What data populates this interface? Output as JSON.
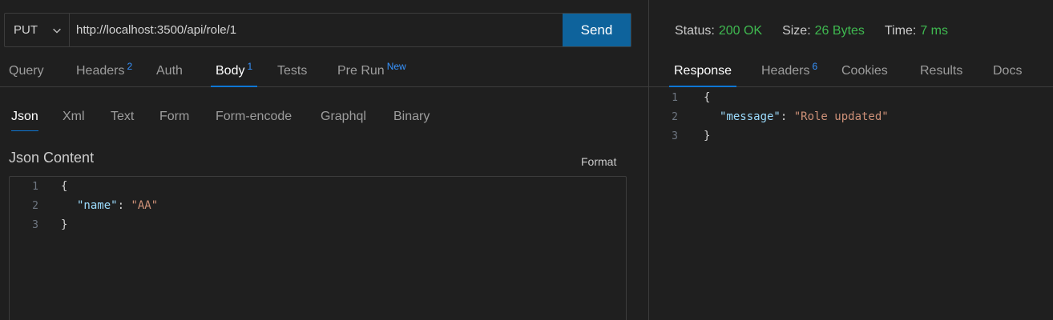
{
  "request": {
    "method": "PUT",
    "url": "http://localhost:3500/api/role/1",
    "send_label": "Send",
    "tabs": [
      {
        "label": "Query",
        "badge": ""
      },
      {
        "label": "Headers",
        "badge": "2"
      },
      {
        "label": "Auth",
        "badge": ""
      },
      {
        "label": "Body",
        "badge": "1"
      },
      {
        "label": "Tests",
        "badge": ""
      },
      {
        "label": "Pre Run",
        "badge": "New"
      }
    ],
    "active_tab": "Body",
    "body_types": [
      "Json",
      "Xml",
      "Text",
      "Form",
      "Form-encode",
      "Graphql",
      "Binary"
    ],
    "active_body_type": "Json",
    "content_label": "Json Content",
    "format_label": "Format",
    "editor_lines": [
      {
        "num": "1",
        "text": "{"
      },
      {
        "num": "2",
        "key": "\"name\"",
        "sep": ": ",
        "value": "\"AA\""
      },
      {
        "num": "3",
        "text": "}"
      }
    ]
  },
  "response": {
    "status_label": "Status:",
    "status_value": "200 OK",
    "size_label": "Size:",
    "size_value": "26 Bytes",
    "time_label": "Time:",
    "time_value": "7 ms",
    "tabs": [
      {
        "label": "Response",
        "badge": ""
      },
      {
        "label": "Headers",
        "badge": "6"
      },
      {
        "label": "Cookies",
        "badge": ""
      },
      {
        "label": "Results",
        "badge": ""
      },
      {
        "label": "Docs",
        "badge": ""
      }
    ],
    "active_tab": "Response",
    "lines": [
      {
        "num": "1",
        "text": "{"
      },
      {
        "num": "2",
        "key": "\"message\"",
        "sep": ": ",
        "value": "\"Role updated\""
      },
      {
        "num": "3",
        "text": "}"
      }
    ]
  },
  "colors": {
    "accent": "#0e639c",
    "success": "#3fb950",
    "json_key": "#9cdcfe",
    "json_string": "#ce9178"
  }
}
